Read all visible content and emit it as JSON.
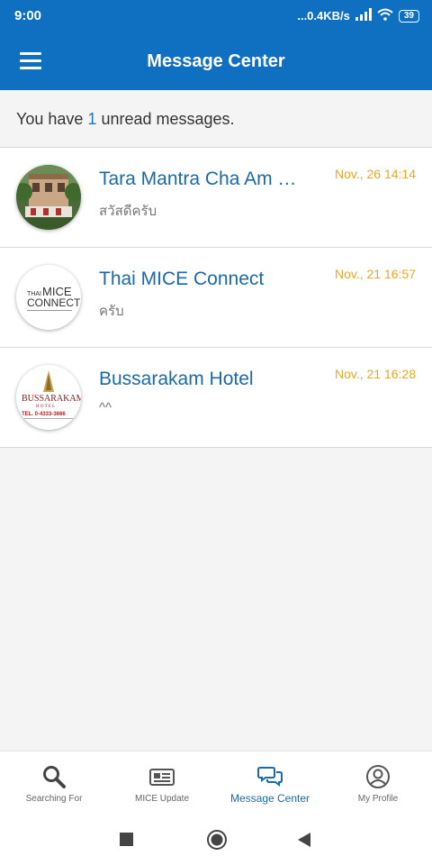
{
  "status_bar": {
    "time": "9:00",
    "network_speed": "...0.4KB/s",
    "battery": "39"
  },
  "app_bar": {
    "title": "Message Center",
    "menu_icon": "hamburger-menu-icon"
  },
  "unread": {
    "prefix": "You have ",
    "count": "1",
    "suffix": " unread messages."
  },
  "messages": [
    {
      "name": "Tara Mantra Cha Am R...",
      "preview": "สวัสดีครับ",
      "time": "Nov., 26 14:14",
      "avatar": "hotel-photo-avatar"
    },
    {
      "name": "Thai MICE Connect",
      "preview": "ครับ",
      "time": "Nov., 21 16:57",
      "avatar": "thai-mice-connect-logo"
    },
    {
      "name": "Bussarakam Hotel",
      "preview": "^^",
      "time": "Nov., 21 16:28",
      "avatar": "bussarakam-hotel-logo"
    }
  ],
  "logos": {
    "thai": "THAI",
    "mice": "MICE",
    "connect": "CONNECT",
    "bussarakam": "BUSSARAKAM",
    "hotel": "H O T E L",
    "tel": "TEL. 0-4333-3666"
  },
  "bottom_nav": [
    {
      "label": "Searching For",
      "icon": "search-icon",
      "active": false
    },
    {
      "label": "MICE Update",
      "icon": "newspaper-icon",
      "active": false
    },
    {
      "label": "Message Center",
      "icon": "chat-bubbles-icon",
      "active": true
    },
    {
      "label": "My Profile",
      "icon": "user-circle-icon",
      "active": false
    }
  ],
  "colors": {
    "primary": "#0f6fc0",
    "link": "#1a6aa8",
    "time": "#e8a820"
  }
}
